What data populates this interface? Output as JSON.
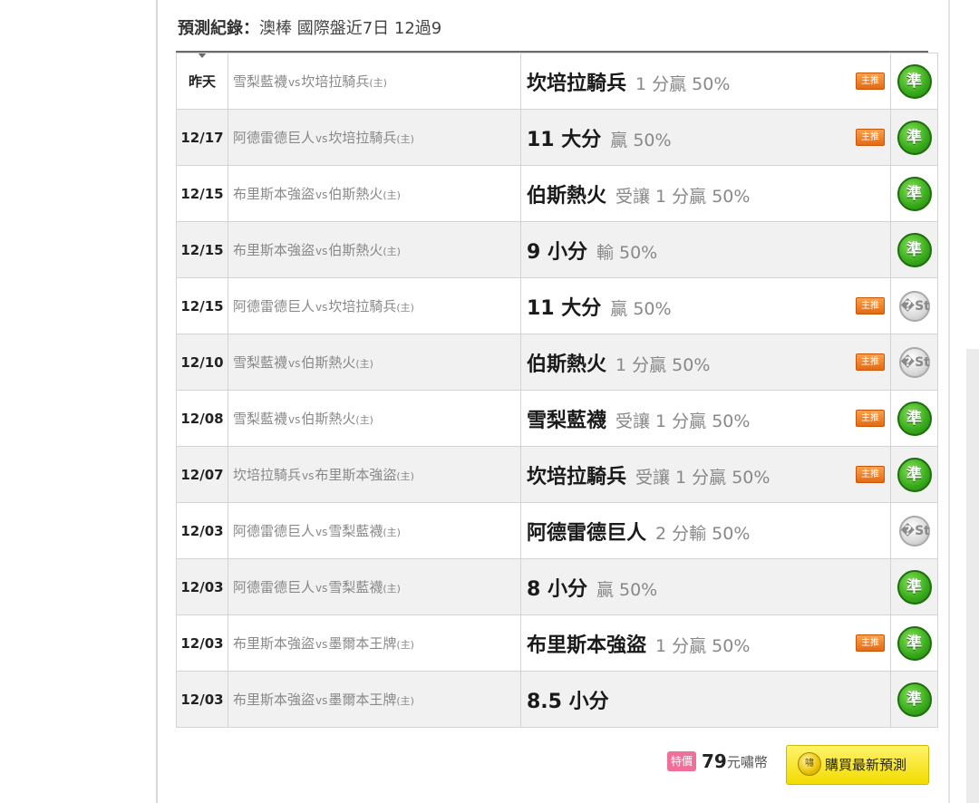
{
  "header": {
    "label": "預測紀錄：",
    "value": "澳棒 國際盤近7日 12過9"
  },
  "labels": {
    "vs": "vs",
    "home": "(主)",
    "main_badge": "主推"
  },
  "results": {
    "hit": "準",
    "miss": "�St"
  },
  "rows": [
    {
      "date": "昨天",
      "away": "雪梨藍襪",
      "home": "坎培拉騎兵",
      "pick": "坎培拉騎兵",
      "detail": "1 分贏 50%",
      "main": true,
      "result": "hit"
    },
    {
      "date": "12/17",
      "away": "阿德雷德巨人",
      "home": "坎培拉騎兵",
      "pick": "11 大分",
      "detail": "贏 50%",
      "main": true,
      "result": "hit"
    },
    {
      "date": "12/15",
      "away": "布里斯本強盜",
      "home": "伯斯熱火",
      "pick": "伯斯熱火",
      "detail": "受讓 1 分贏 50%",
      "main": false,
      "result": "hit"
    },
    {
      "date": "12/15",
      "away": "布里斯本強盜",
      "home": "伯斯熱火",
      "pick": "9 小分",
      "detail": "輸 50%",
      "main": false,
      "result": "hit"
    },
    {
      "date": "12/15",
      "away": "阿德雷德巨人",
      "home": "坎培拉騎兵",
      "pick": "11 大分",
      "detail": "贏 50%",
      "main": true,
      "result": "miss"
    },
    {
      "date": "12/10",
      "away": "雪梨藍襪",
      "home": "伯斯熱火",
      "pick": "伯斯熱火",
      "detail": "1 分贏 50%",
      "main": true,
      "result": "miss"
    },
    {
      "date": "12/08",
      "away": "雪梨藍襪",
      "home": "伯斯熱火",
      "pick": "雪梨藍襪",
      "detail": "受讓 1 分贏 50%",
      "main": true,
      "result": "hit"
    },
    {
      "date": "12/07",
      "away": "坎培拉騎兵",
      "home": "布里斯本強盜",
      "pick": "坎培拉騎兵",
      "detail": "受讓 1 分贏 50%",
      "main": true,
      "result": "hit"
    },
    {
      "date": "12/03",
      "away": "阿德雷德巨人",
      "home": "雪梨藍襪",
      "pick": "阿德雷德巨人",
      "detail": "2 分輸 50%",
      "main": false,
      "result": "miss"
    },
    {
      "date": "12/03",
      "away": "阿德雷德巨人",
      "home": "雪梨藍襪",
      "pick": "8 小分",
      "detail": "贏 50%",
      "main": false,
      "result": "hit"
    },
    {
      "date": "12/03",
      "away": "布里斯本強盜",
      "home": "墨爾本王牌",
      "pick": "布里斯本強盜",
      "detail": "1 分贏 50%",
      "main": true,
      "result": "hit"
    },
    {
      "date": "12/03",
      "away": "布里斯本強盜",
      "home": "墨爾本王牌",
      "pick": "8.5 小分",
      "detail": "",
      "main": false,
      "result": "hit"
    }
  ],
  "footer": {
    "special_badge": "特價",
    "price": "79",
    "currency": "元嘯幣",
    "coin_icon": "嘯",
    "buy_label": "購買最新預測"
  }
}
